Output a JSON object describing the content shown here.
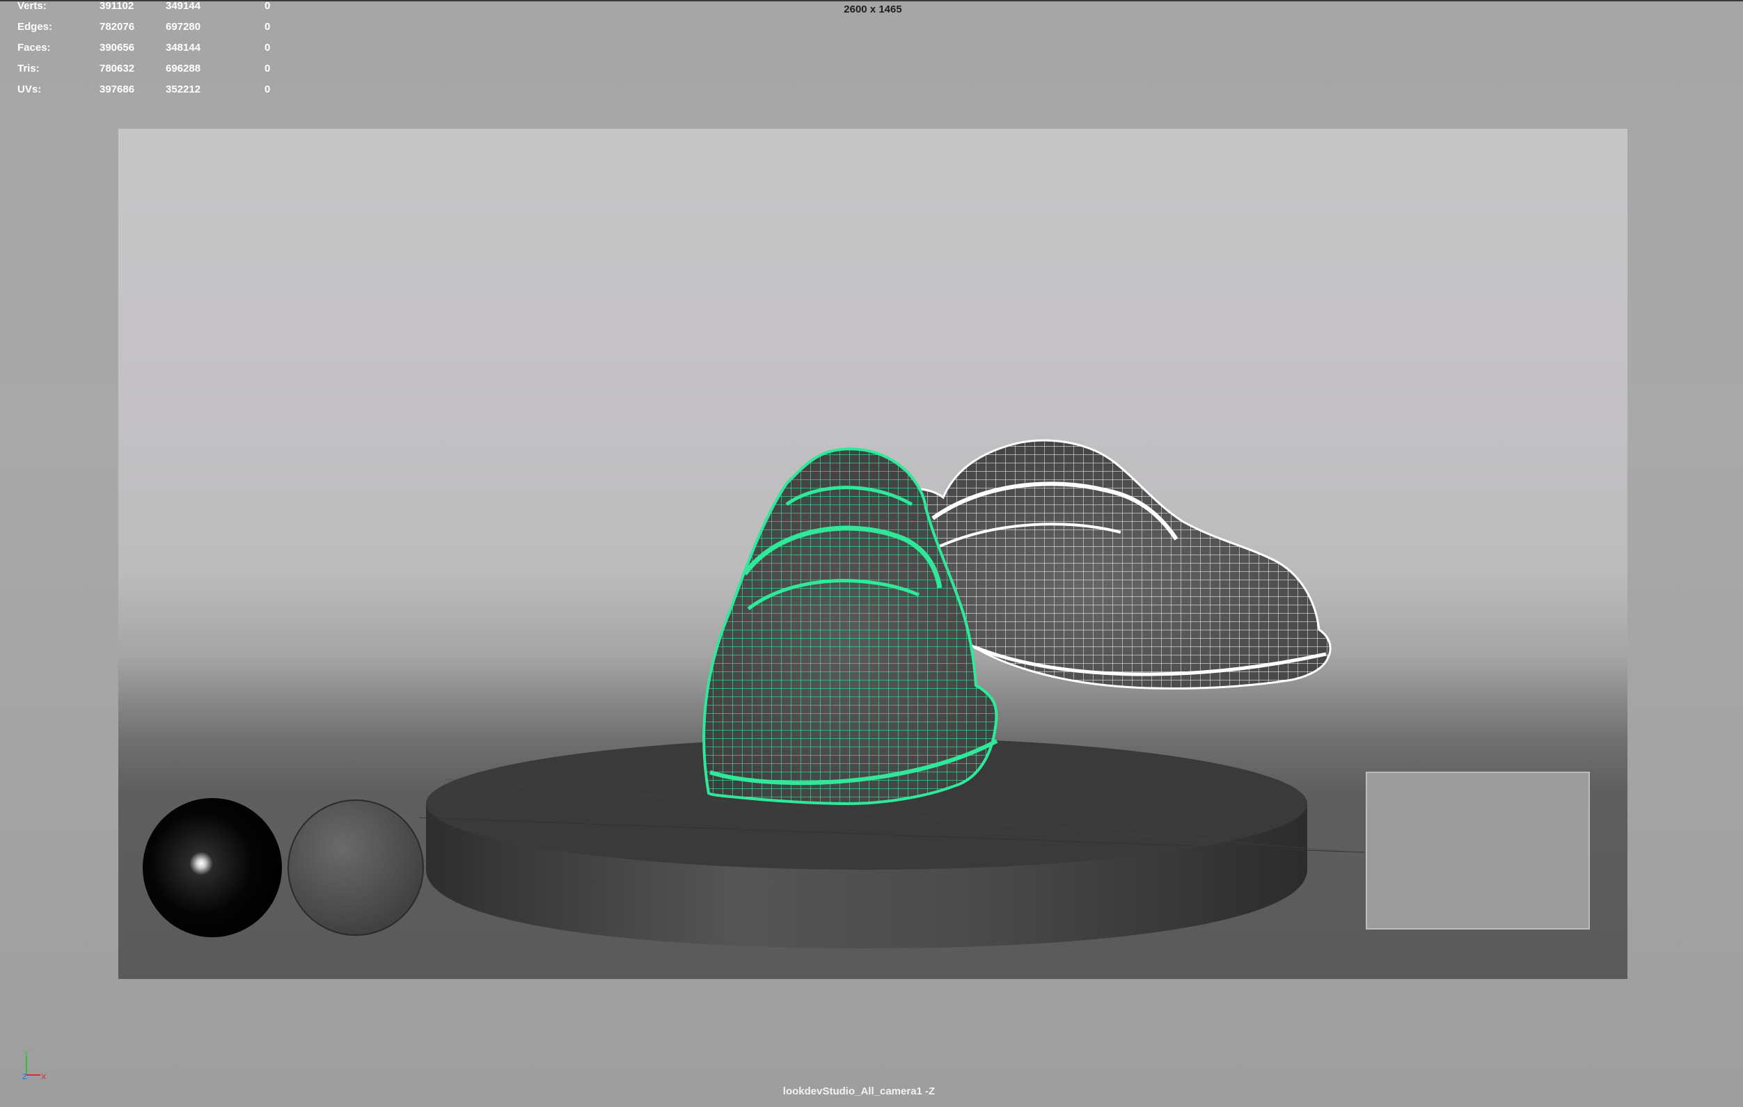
{
  "hud": {
    "rows": [
      {
        "label": "Verts:",
        "v1": "391102",
        "v2": "349144",
        "v3": "0"
      },
      {
        "label": "Edges:",
        "v1": "782076",
        "v2": "697280",
        "v3": "0"
      },
      {
        "label": "Faces:",
        "v1": "390656",
        "v2": "348144",
        "v3": "0"
      },
      {
        "label": "Tris:",
        "v1": "780632",
        "v2": "696288",
        "v3": "0"
      },
      {
        "label": "UVs:",
        "v1": "397686",
        "v2": "352212",
        "v3": "0"
      }
    ]
  },
  "resolution_gate": "2600 x 1465",
  "camera": "lookdevStudio_All_camera1 -Z",
  "axis": {
    "y": "Y",
    "z": "Z",
    "x": "X"
  },
  "colors": {
    "selected_wireframe": "#2fe89a",
    "wireframe": "#ffffff",
    "viewport_bg": "#a8a8a8",
    "axis_x": "#d23030",
    "axis_y": "#30c040",
    "axis_z": "#3060e0"
  },
  "scene": {
    "objects": [
      "chrome-sphere",
      "gray-sphere",
      "turntable",
      "shoe-left-selected",
      "shoe-right",
      "color-checker-card"
    ]
  }
}
